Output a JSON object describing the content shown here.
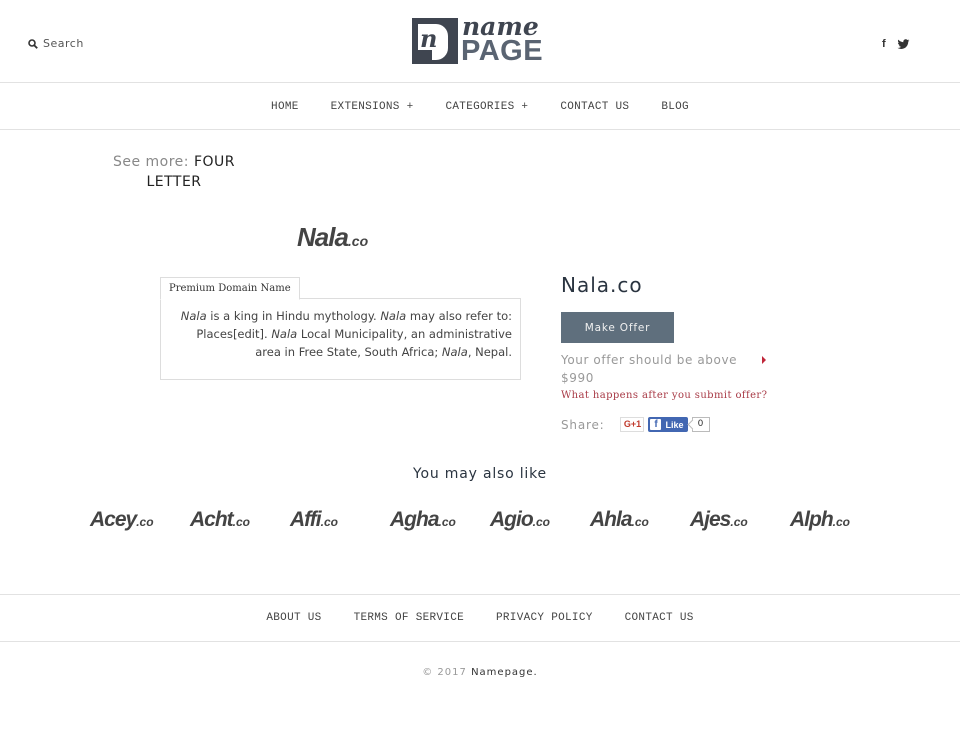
{
  "header": {
    "search_label": "Search",
    "logo": {
      "top_text": "name",
      "bottom_text": "PAGE",
      "mark_letter": "n"
    },
    "social": [
      {
        "name": "facebook-icon",
        "glyph": "f"
      },
      {
        "name": "twitter-icon"
      }
    ]
  },
  "nav": {
    "items": [
      {
        "label": "HOME"
      },
      {
        "label": "EXTENSIONS +"
      },
      {
        "label": "CATEGORIES +"
      },
      {
        "label": "CONTACT US"
      },
      {
        "label": "BLOG"
      }
    ]
  },
  "see_more": {
    "label": "See more:",
    "link": "FOUR LETTER"
  },
  "domain": {
    "logo_name": "Nala",
    "logo_tld": ".co",
    "full_name": "Nala.co",
    "tab_label": "Premium Domain Name",
    "description": {
      "parts": [
        {
          "text": "Nala",
          "italic": true
        },
        {
          "text": " is a king in Hindu mythology. ",
          "italic": false
        },
        {
          "text": "Nala",
          "italic": true
        },
        {
          "text": " may also refer to: Places[edit]. ",
          "italic": false
        },
        {
          "text": "Nala",
          "italic": true
        },
        {
          "text": " Local Municipality, an administrative area in Free State, South Africa; ",
          "italic": false
        },
        {
          "text": "Nala",
          "italic": true
        },
        {
          "text": ", Nepal.",
          "italic": false
        }
      ]
    }
  },
  "offer": {
    "button_label": "Make Offer",
    "min_text": "Your offer should be above",
    "min_price": "$990",
    "help_link": "What happens after you submit offer?",
    "accent_color": "#c0273a"
  },
  "share": {
    "label": "Share:",
    "gplus_label": "G+1",
    "fb_glyph": "f",
    "fb_label": "Like",
    "fb_count": "0"
  },
  "also_like": {
    "title": "You may also like",
    "items": [
      {
        "name": "Acey",
        "tld": ".co"
      },
      {
        "name": "Acht",
        "tld": ".co"
      },
      {
        "name": "Affi",
        "tld": ".co"
      },
      {
        "name": "Agha",
        "tld": ".co"
      },
      {
        "name": "Agio",
        "tld": ".co"
      },
      {
        "name": "Ahla",
        "tld": ".co"
      },
      {
        "name": "Ajes",
        "tld": ".co"
      },
      {
        "name": "Alph",
        "tld": ".co"
      }
    ]
  },
  "footer": {
    "links": [
      {
        "label": "ABOUT US"
      },
      {
        "label": "TERMS OF SERVICE"
      },
      {
        "label": "PRIVACY POLICY"
      },
      {
        "label": "CONTACT US"
      }
    ],
    "copyright": "© 2017",
    "brand": "Namepage."
  },
  "colors": {
    "button_bg": "#5f6f7d",
    "link_red": "#a83a46",
    "facebook_blue": "#4267b2",
    "logo_dark": "#3f4550"
  }
}
